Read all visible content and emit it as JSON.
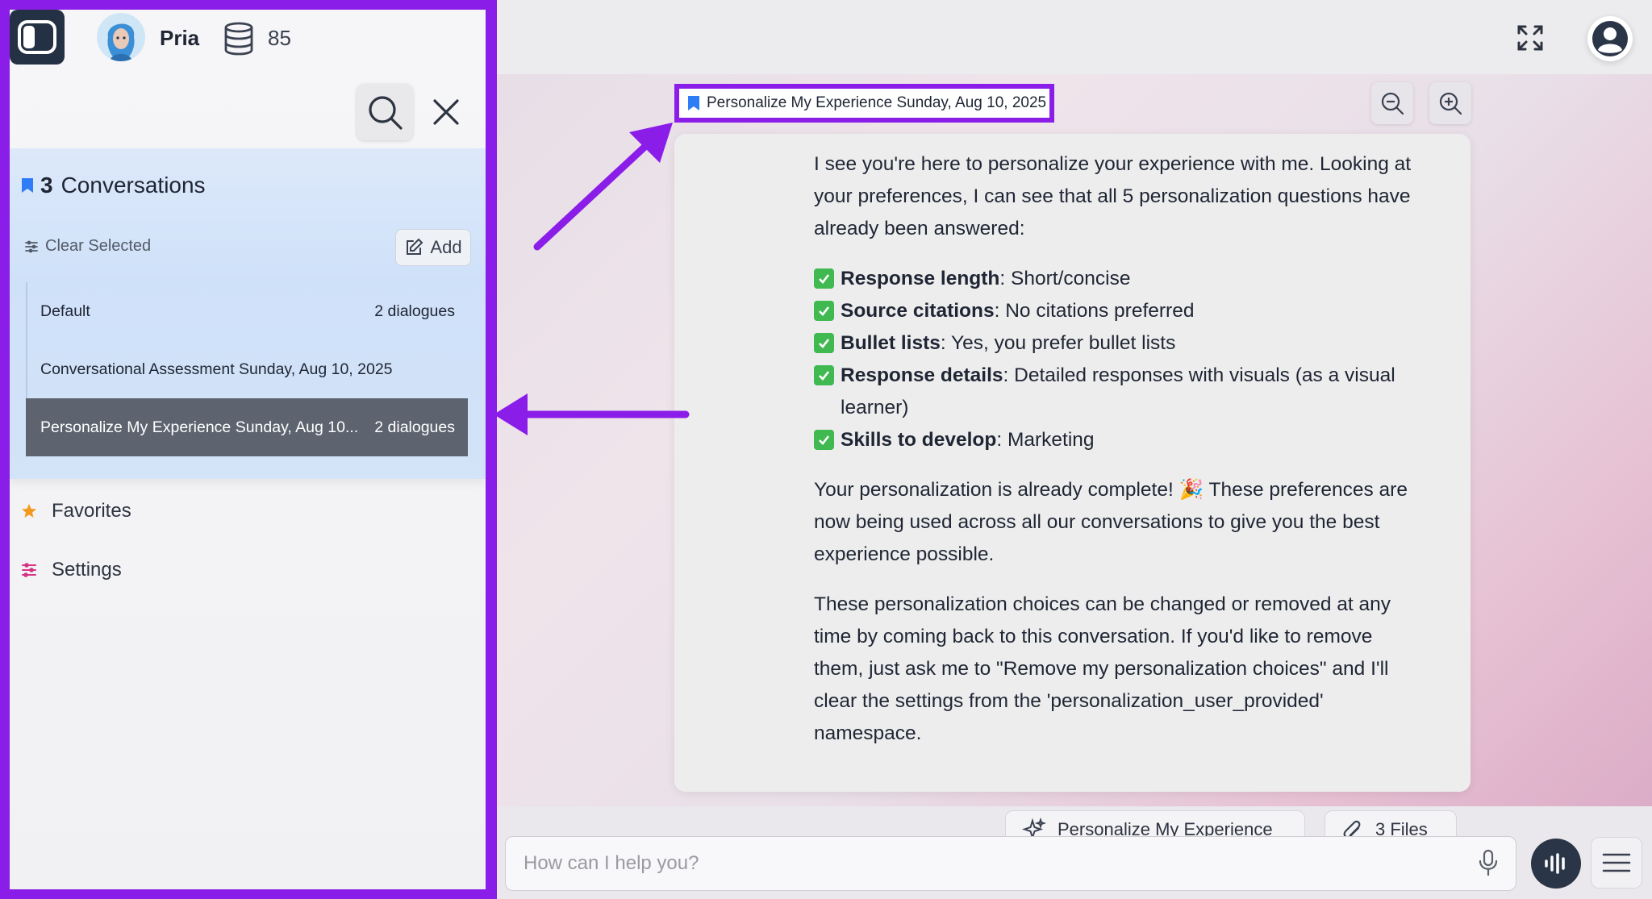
{
  "sidebar": {
    "user_name": "Pria",
    "credits": "85",
    "conversations": {
      "count": "3",
      "label": "Conversations",
      "clear_selected": "Clear Selected",
      "add_label": "Add",
      "items": [
        {
          "title": "Default",
          "count": "2 dialogues",
          "active": false
        },
        {
          "title": "Conversational Assessment Sunday, Aug 10, 2025",
          "count": "",
          "active": false
        },
        {
          "title": "Personalize My Experience Sunday, Aug 10...",
          "count": "2 dialogues",
          "active": true
        }
      ]
    },
    "favorites_label": "Favorites",
    "settings_label": "Settings"
  },
  "main": {
    "doc_tag": "Personalize My Experience Sunday, Aug 10, 2025",
    "message": {
      "intro": "I see you're here to personalize your experience with me. Looking at your preferences, I can see that all 5 personalization questions have already been answered:",
      "items": [
        {
          "key": "Response length",
          "value": ": Short/concise"
        },
        {
          "key": "Source citations",
          "value": ": No citations preferred"
        },
        {
          "key": "Bullet lists",
          "value": ": Yes, you prefer bullet lists"
        },
        {
          "key": "Response details",
          "value": ": Detailed responses with visuals (as a visual learner)"
        },
        {
          "key": "Skills to develop",
          "value": ": Marketing"
        }
      ],
      "complete": "Your personalization is already complete! 🎉 These preferences are now being used across all our conversations to give you the best experience possible.",
      "footer": "These personalization choices can be changed or removed at any time by coming back to this conversation. If you'd like to remove them, just ask me to \"Remove my personalization choices\" and I'll clear the settings from the 'personalization_user_provided' namespace."
    },
    "chip_personalize": "Personalize My Experience",
    "chip_files": "3 Files",
    "input_placeholder": "How can I help you?"
  },
  "colors": {
    "highlight": "#8a1de8",
    "accent_blue": "#2f7df6",
    "active_row": "#5d6470",
    "check_green": "#3fb950"
  }
}
